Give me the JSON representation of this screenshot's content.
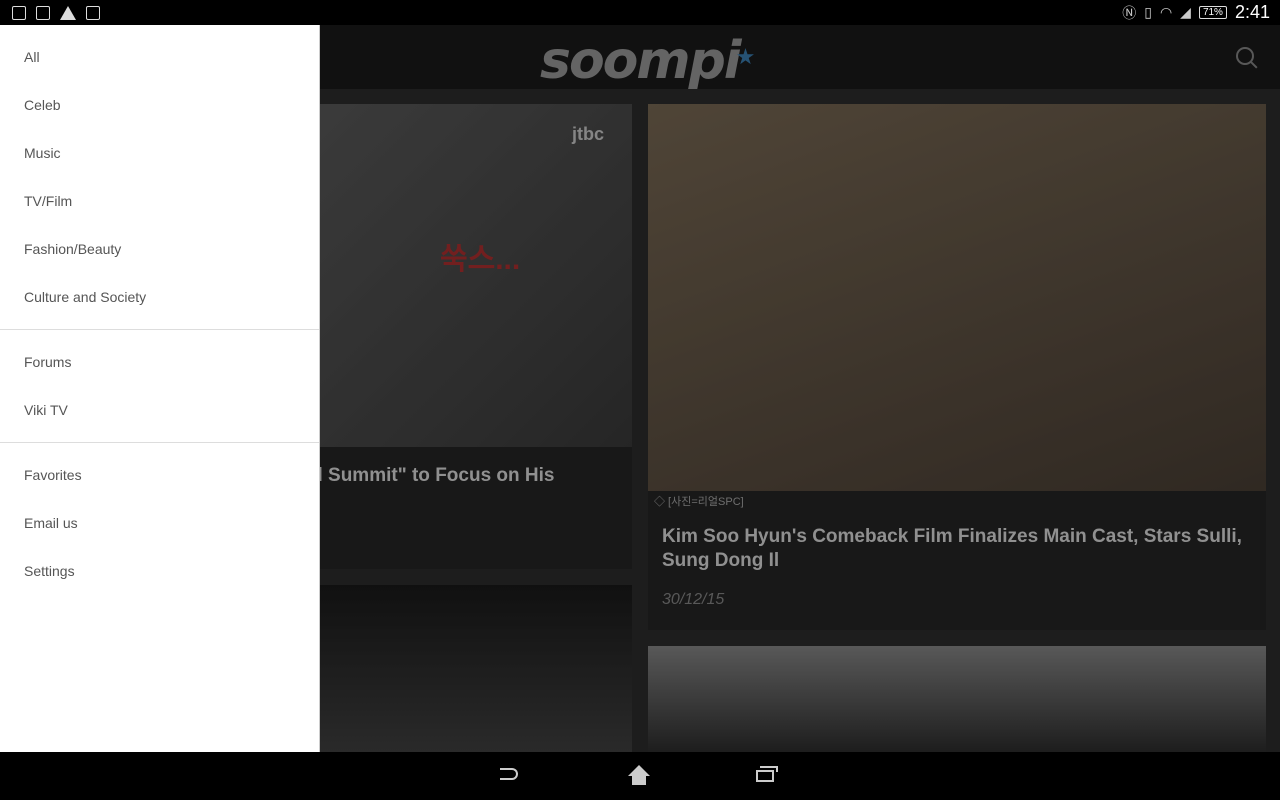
{
  "statusbar": {
    "battery": "71%",
    "time": "2:41"
  },
  "appbar": {
    "logo": "soompi"
  },
  "drawer": {
    "group1": [
      "All",
      "Celeb",
      "Music",
      "TV/Film",
      "Fashion/Beauty",
      "Culture and Society"
    ],
    "group2": [
      "Forums",
      "Viki TV"
    ],
    "group3": [
      "Favorites",
      "Email us",
      "Settings"
    ]
  },
  "cards": {
    "left_title_partial": "mal Summit\" to Focus on His",
    "left_image_text": "쑥스...",
    "left_image_brand": "jtbc",
    "right_caption": "◇ [사진=리얼SPC]",
    "right_title": "Kim Soo Hyun's Comeback Film Finalizes Main Cast, Stars Sulli, Sung Dong Il",
    "right_date": "30/12/15"
  },
  "colors": {
    "accent": "#3b7fb3",
    "drawer_bg": "#ffffff",
    "appbar_bg": "#1b1b1b"
  }
}
